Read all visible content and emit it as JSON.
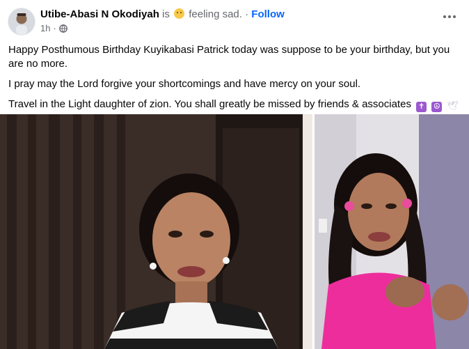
{
  "post": {
    "author": "Utibe-Abasi N Okodiyah",
    "is_text": "is",
    "feeling_text": "feeling sad.",
    "separator": "·",
    "follow_label": "Follow",
    "time": "1h",
    "time_separator": "·"
  },
  "content": {
    "paragraph1": "Happy Posthumous Birthday Kuyikabasi Patrick  today was suppose to be your birthday, but you are no more.",
    "paragraph2": "I pray may the Lord forgive your shortcomings and have mercy on your soul.",
    "paragraph3": "Travel in the Light daughter of zion. You shall greatly be missed by friends & associates",
    "emoji_icons": [
      "latin-cross-icon",
      "peace-symbol-icon",
      "dove-icon"
    ]
  },
  "icons": {
    "more_options": "more-horizontal-icon",
    "audience": "globe-icon"
  },
  "colors": {
    "link_blue": "#0866ff",
    "muted_gray": "#65676b",
    "text": "#050505",
    "emoji_purple": "#9b59d0"
  }
}
